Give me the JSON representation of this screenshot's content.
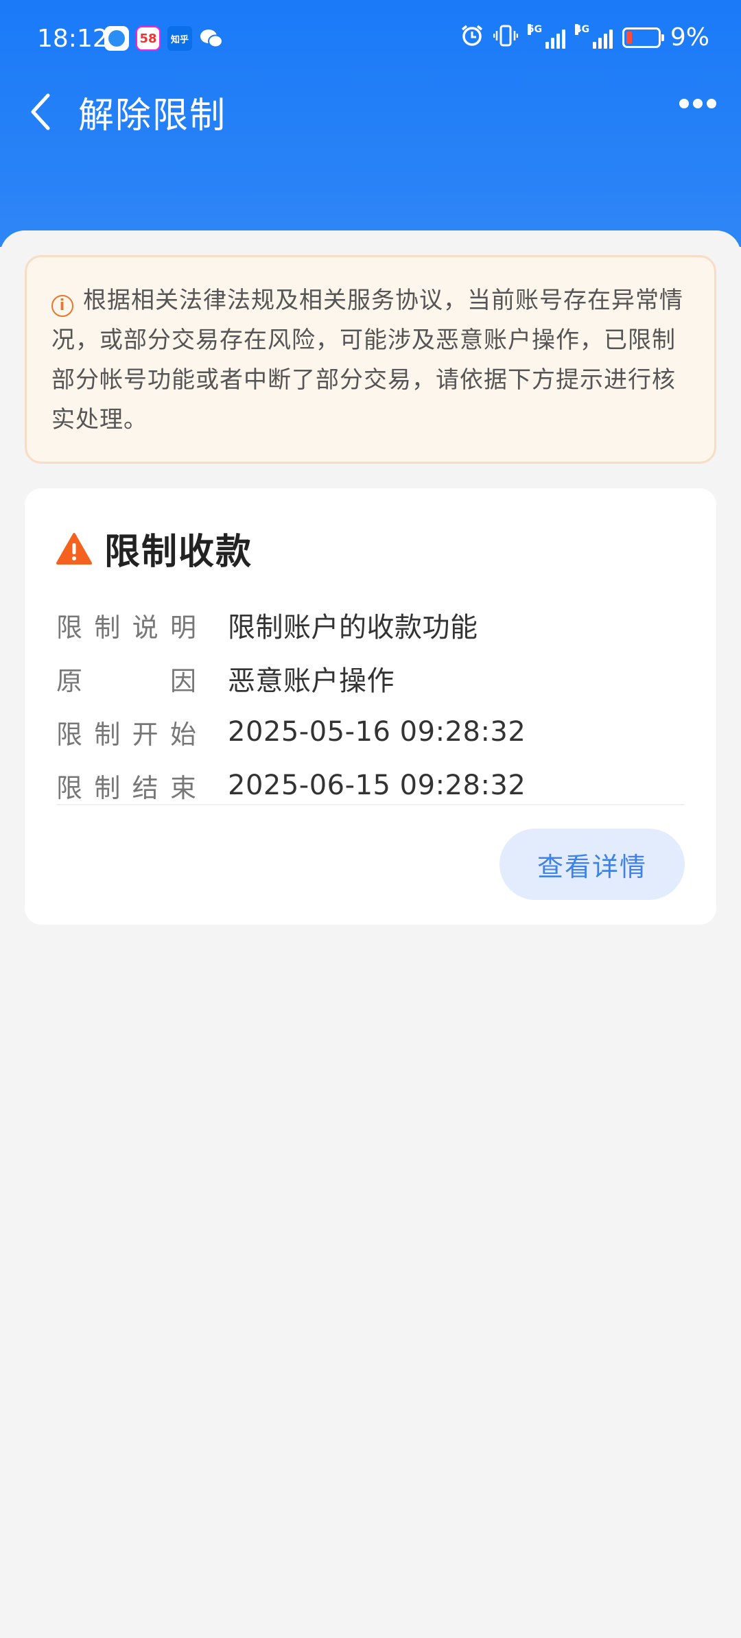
{
  "status_bar": {
    "time": "18:12",
    "app_icons": [
      "browser-icon",
      "58-icon",
      "zhihu-icon",
      "wechat-icon"
    ],
    "zhihu_text": "知乎",
    "fiftyeight_text": "58",
    "network_5g": "5G",
    "network_4g": "4G",
    "battery_percent": "9%",
    "accent_color": "#1a7af8"
  },
  "header": {
    "title": "解除限制"
  },
  "notice": {
    "text": "根据相关法律法规及相关服务协议，当前账号存在异常情况，或部分交易存在风险，可能涉及恶意账户操作，已限制部分帐号功能或者中断了部分交易，请依据下方提示进行核实处理。",
    "color": "#fdf6ec"
  },
  "card": {
    "title": "限制收款",
    "rows": [
      {
        "label": [
          "限",
          "制",
          "说",
          "明"
        ],
        "value": "限制账户的收款功能"
      },
      {
        "label": [
          "原",
          "因"
        ],
        "value": "恶意账户操作"
      },
      {
        "label": [
          "限",
          "制",
          "开",
          "始"
        ],
        "value": "2025-05-16 09:28:32"
      },
      {
        "label": [
          "限",
          "制",
          "结",
          "束"
        ],
        "value": "2025-06-15 09:28:32"
      }
    ],
    "detail_button": "查看详情"
  }
}
